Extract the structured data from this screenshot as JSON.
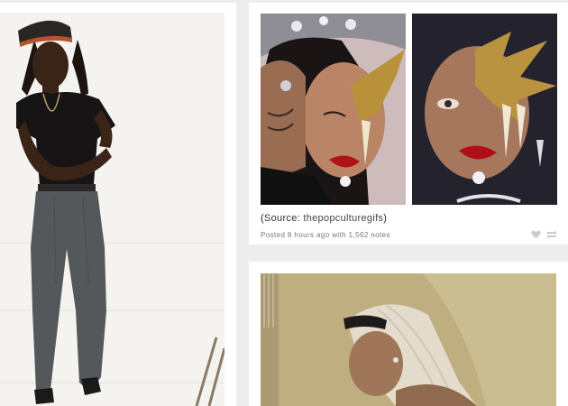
{
  "posts": [
    {
      "id": "photo-man",
      "type": "photo"
    },
    {
      "id": "gifset",
      "type": "photoset",
      "caption": {
        "open": "(",
        "label": "Source:",
        "source": "thepopculturegifs",
        "close": ")"
      },
      "meta": "Posted 8 hours ago with 1,562 notes",
      "actions": {
        "like_icon": "heart-icon",
        "reblog_icon": "reblog-icon"
      }
    },
    {
      "id": "photo-braids",
      "type": "photo"
    }
  ],
  "colors": {
    "background": "#ededed",
    "card": "#ffffff",
    "text": "#333333",
    "meta": "#777777",
    "icon": "#cccccc"
  }
}
